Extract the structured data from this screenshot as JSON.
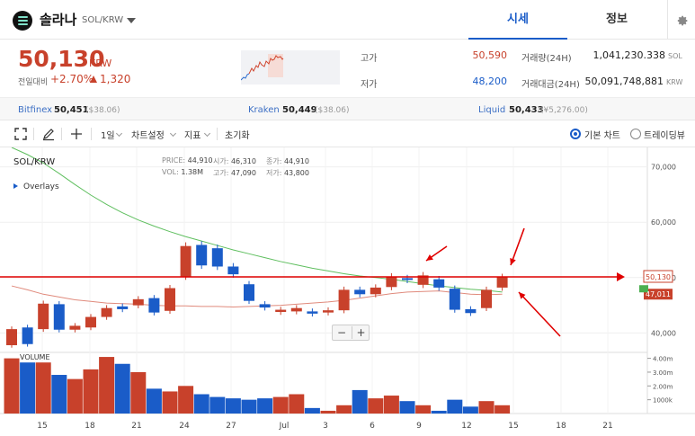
{
  "header": {
    "coin_name": "솔라나",
    "pair": "SOL/KRW",
    "tabs": [
      {
        "label": "시세",
        "active": true
      },
      {
        "label": "정보",
        "active": false
      }
    ],
    "icons": {
      "logo": "solana-logo-icon",
      "caret": "chevron-down-icon",
      "settings": "gear-icon"
    }
  },
  "summary": {
    "price": "50,130",
    "unit": "KRW",
    "change_label": "전일대비",
    "change_rate": "+2.70%",
    "change_amount": "1,320",
    "high_label": "고가",
    "high_value": "50,590",
    "low_label": "저가",
    "low_value": "48,200",
    "volume_label": "거래량(24H)",
    "volume_value": "1,041,230.338",
    "volume_unit": "SOL",
    "amount_label": "거래대금(24H)",
    "amount_value": "50,091,748,881",
    "amount_unit": "KRW",
    "colors": {
      "up": "#c8412b",
      "down": "#1a5cc8"
    }
  },
  "exchanges": [
    {
      "name": "Bitfinex",
      "value": "50,451",
      "sub": "($38.06)"
    },
    {
      "name": "Kraken",
      "value": "50,449",
      "sub": "($38.06)"
    },
    {
      "name": "Liquid",
      "value": "50,433",
      "sub": "(¥5,276.00)"
    }
  ],
  "toolbar": {
    "interval": "1일",
    "chart_settings": "차트설정",
    "indicators": "지표",
    "reset": "초기화",
    "basic_chart": "기본 차트",
    "tradingview": "트레이딩뷰",
    "icons": [
      "fullscreen-icon",
      "pencil-icon",
      "crosshair-icon"
    ]
  },
  "chart": {
    "symbol": "SOL/KRW",
    "overlays_label": "Overlays",
    "ohlc": {
      "price_label": "PRICE:",
      "price": "44,910",
      "open_label": "시가:",
      "open": "46,310",
      "close_label": "종가:",
      "close": "44,910",
      "vol_label": "VOL:",
      "vol": "1.38M",
      "high_label": "고가:",
      "high": "47,090",
      "low_label": "저가:",
      "low": "43,800"
    },
    "volume_label": "VOLUME",
    "zoom_out": "−",
    "zoom_in": "+"
  },
  "chart_data": {
    "type": "candlestick",
    "y_ticks": [
      40000,
      50000,
      60000,
      70000
    ],
    "y_tick_labels": [
      "40,000",
      "50,000",
      "60,000",
      "70,000"
    ],
    "x_tick_labels": [
      "15",
      "18",
      "21",
      "24",
      "27",
      "Jul",
      "3",
      "6",
      "9",
      "12",
      "15",
      "18",
      "21"
    ],
    "ylim": [
      36500,
      73500
    ],
    "current_price_label": "50,130",
    "ma_label": "47,011",
    "volume_ticks": [
      "4.00m",
      "3.00m",
      "2.00m",
      "1000k"
    ],
    "candles": [
      {
        "o": 37800,
        "c": 40700,
        "v": 4.0
      },
      {
        "o": 41000,
        "c": 38000,
        "v": 3.7
      },
      {
        "o": 40700,
        "c": 45300,
        "v": 3.7
      },
      {
        "o": 45200,
        "c": 40600,
        "v": 2.8
      },
      {
        "o": 40600,
        "c": 41300,
        "v": 2.5
      },
      {
        "o": 41000,
        "c": 42900,
        "v": 3.2
      },
      {
        "o": 42900,
        "c": 44500,
        "v": 4.1
      },
      {
        "o": 44800,
        "c": 44300,
        "v": 3.6
      },
      {
        "o": 45000,
        "c": 46100,
        "v": 3.0
      },
      {
        "o": 46300,
        "c": 43700,
        "v": 1.8
      },
      {
        "o": 44000,
        "c": 48100,
        "v": 1.6
      },
      {
        "o": 50200,
        "c": 55700,
        "v": 2.0
      },
      {
        "o": 55900,
        "c": 52200,
        "v": 1.4
      },
      {
        "o": 55300,
        "c": 52000,
        "v": 1.2
      },
      {
        "o": 52000,
        "c": 50600,
        "v": 1.1
      },
      {
        "o": 48800,
        "c": 45800,
        "v": 1.0
      },
      {
        "o": 45200,
        "c": 44600,
        "v": 1.1
      },
      {
        "o": 43800,
        "c": 44200,
        "v": 1.2
      },
      {
        "o": 43900,
        "c": 44500,
        "v": 1.4
      },
      {
        "o": 43900,
        "c": 43500,
        "v": 0.4
      },
      {
        "o": 43700,
        "c": 44100,
        "v": 0.2
      },
      {
        "o": 44100,
        "c": 47800,
        "v": 0.6
      },
      {
        "o": 47800,
        "c": 47000,
        "v": 1.7
      },
      {
        "o": 47000,
        "c": 48200,
        "v": 1.1
      },
      {
        "o": 48300,
        "c": 50200,
        "v": 1.3
      },
      {
        "o": 49900,
        "c": 49600,
        "v": 0.9
      },
      {
        "o": 48700,
        "c": 50400,
        "v": 0.6
      },
      {
        "o": 49700,
        "c": 48200,
        "v": 0.2
      },
      {
        "o": 48000,
        "c": 44200,
        "v": 1.0
      },
      {
        "o": 44300,
        "c": 43600,
        "v": 0.5
      },
      {
        "o": 44500,
        "c": 47800,
        "v": 0.9
      },
      {
        "o": 48200,
        "c": 50100,
        "v": 0.6
      }
    ],
    "ma_series": [
      [
        48500,
        47800,
        47000,
        46500,
        46000,
        45700,
        45400,
        45300,
        45200,
        45000,
        44900,
        44900,
        44800,
        44800,
        44700,
        44800,
        44900,
        45000,
        45200,
        45400,
        45600,
        45900,
        46300,
        46700,
        47100,
        47400,
        47500,
        47600,
        47300,
        47000,
        46900,
        47000
      ],
      [
        73500,
        72200,
        70700,
        68800,
        66800,
        64900,
        63200,
        61700,
        60400,
        59300,
        58300,
        57400,
        56600,
        55800,
        55000,
        54300,
        53600,
        52900,
        52300,
        51700,
        51200,
        50700,
        50300,
        50000,
        49700,
        49300,
        48900,
        48500,
        48200,
        47900,
        47700,
        47400
      ]
    ]
  }
}
